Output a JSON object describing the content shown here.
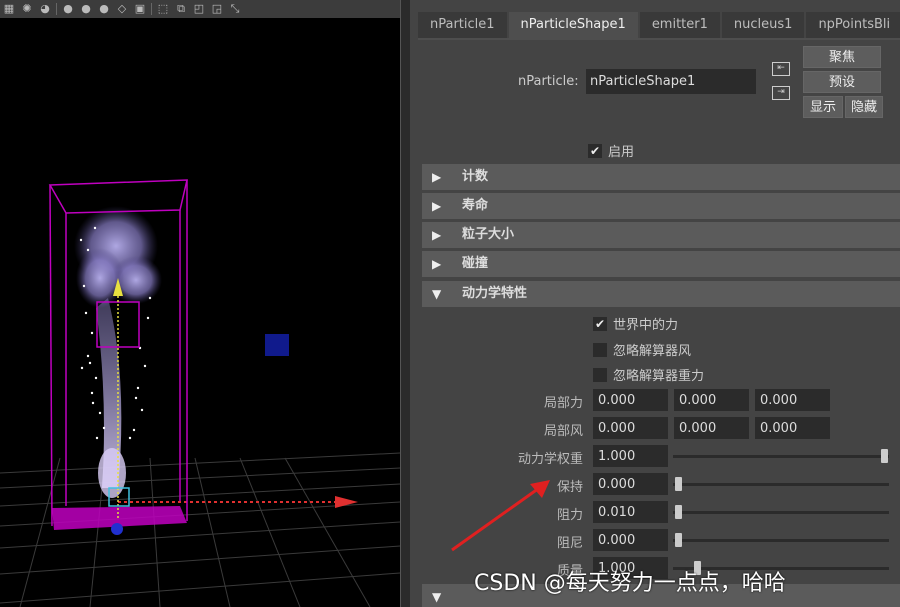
{
  "toolbar": {
    "icons": [
      "grid-icon",
      "light-icon",
      "shading-icon",
      "separator",
      "sphere-icon",
      "sphere-icon",
      "sphere-icon",
      "diamond-icon",
      "texture-icon",
      "separator",
      "select-icon",
      "isolate-icon",
      "layout-icon",
      "layout-icon",
      "frame-icon"
    ]
  },
  "tabs": [
    {
      "label": "nParticle1",
      "active": false
    },
    {
      "label": "nParticleShape1",
      "active": true
    },
    {
      "label": "emitter1",
      "active": false
    },
    {
      "label": "nucleus1",
      "active": false
    },
    {
      "label": "npPointsBli",
      "active": false
    }
  ],
  "node": {
    "label": "nParticle:",
    "value": "nParticleShape1"
  },
  "buttons": {
    "focus": "聚焦",
    "preset": "预设",
    "show": "显示",
    "hide": "隐藏"
  },
  "enable": {
    "label": "启用",
    "checked": true
  },
  "sections": [
    {
      "label": "计数",
      "expanded": false
    },
    {
      "label": "寿命",
      "expanded": false
    },
    {
      "label": "粒子大小",
      "expanded": false
    },
    {
      "label": "碰撞",
      "expanded": false
    },
    {
      "label": "动力学特性",
      "expanded": true
    }
  ],
  "dynamics": {
    "checks": [
      {
        "label": "世界中的力",
        "checked": true
      },
      {
        "label": "忽略解算器风",
        "checked": false
      },
      {
        "label": "忽略解算器重力",
        "checked": false
      }
    ],
    "local_force": {
      "label": "局部力",
      "values": [
        "0.000",
        "0.000",
        "0.000"
      ]
    },
    "local_wind": {
      "label": "局部风",
      "values": [
        "0.000",
        "0.000",
        "0.000"
      ]
    },
    "dynamics_weight": {
      "label": "动力学权重",
      "value": "1.000",
      "slider": 1.0
    },
    "conserve": {
      "label": "保持",
      "value": "0.000",
      "slider": 0.0
    },
    "drag": {
      "label": "阻力",
      "value": "0.010",
      "slider": 0.0
    },
    "damp": {
      "label": "阻尼",
      "value": "0.000",
      "slider": 0.0
    },
    "mass": {
      "label": "质量",
      "value": "1.000",
      "slider": 0.1
    }
  },
  "watermark": "CSDN @每天努力一点点，哈哈",
  "colors": {
    "bounding_box": "#c000c0",
    "arrow": "#e03030",
    "particle": "#9b8cd6"
  }
}
